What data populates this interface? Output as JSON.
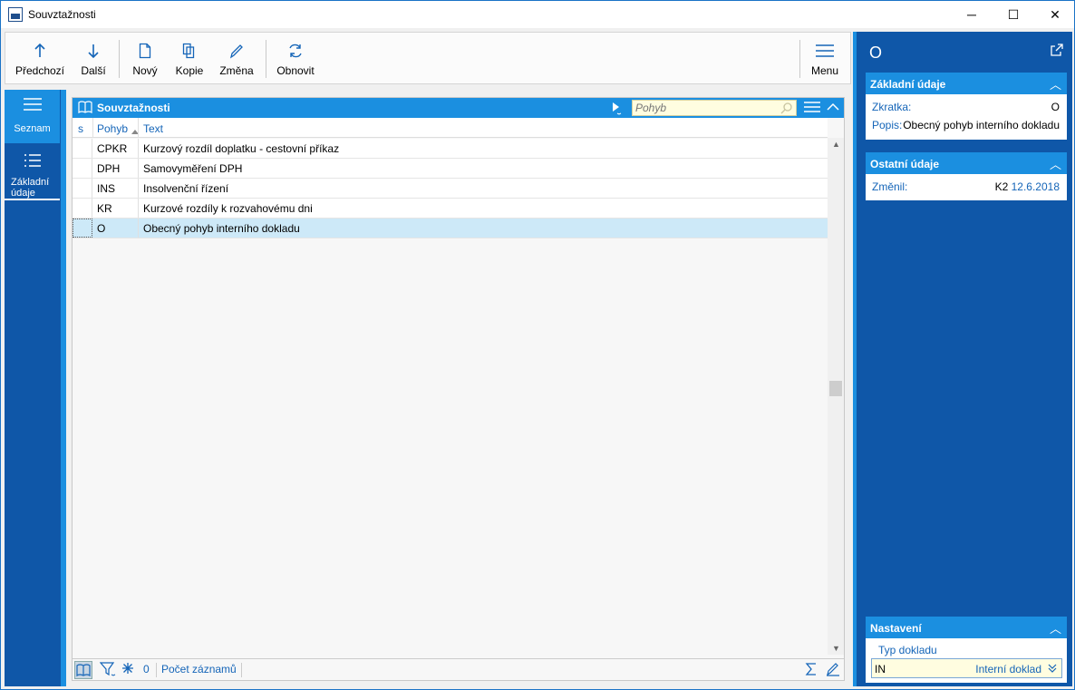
{
  "window": {
    "title": "Souvztažnosti",
    "min_glyph": "─",
    "max_glyph": "☐",
    "close_glyph": "✕"
  },
  "toolbar": {
    "buttons": [
      {
        "label": "Předchozí",
        "icon": "arrow-up-icon"
      },
      {
        "label": "Další",
        "icon": "arrow-down-icon"
      },
      {
        "label": "Nový",
        "icon": "new-document-icon"
      },
      {
        "label": "Kopie",
        "icon": "copy-icon"
      },
      {
        "label": "Změna",
        "icon": "pencil-icon"
      },
      {
        "label": "Obnovit",
        "icon": "refresh-icon"
      },
      {
        "label": "Menu",
        "icon": "hamburger-icon"
      }
    ]
  },
  "leftnav": {
    "items": [
      {
        "label": "Seznam",
        "icon": "hamburger-icon"
      },
      {
        "label": "Základní údaje",
        "icon": "list-icon"
      }
    ]
  },
  "grid": {
    "title": "Souvztažnosti",
    "search_placeholder": "Pohyb",
    "columns": [
      "s",
      "Pohyb",
      "Text"
    ],
    "rows": [
      {
        "pohyb": "CPKR",
        "text": "Kurzový rozdíl doplatku - cestovní příkaz",
        "selected": false
      },
      {
        "pohyb": "DPH",
        "text": "Samovyměření DPH",
        "selected": false
      },
      {
        "pohyb": "INS",
        "text": "Insolvenční řízení",
        "selected": false
      },
      {
        "pohyb": "KR",
        "text": "Kurzové rozdíly k rozvahovému dni",
        "selected": false
      },
      {
        "pohyb": "O",
        "text": "Obecný pohyb interního dokladu",
        "selected": true
      }
    ],
    "footer": {
      "count_value": "0",
      "count_label": "Počet záznamů"
    }
  },
  "rightpanel": {
    "title": "O",
    "zakladni": {
      "header": "Základní údaje",
      "zkratka_label": "Zkratka:",
      "zkratka_value": "O",
      "popis_label": "Popis:",
      "popis_value": "Obecný pohyb interního dokladu"
    },
    "ostatni": {
      "header": "Ostatní údaje",
      "zmenil_label": "Změnil:",
      "zmenil_user": "K2",
      "zmenil_date": "12.6.2018"
    },
    "nastaveni": {
      "header": "Nastavení",
      "typ_label": "Typ dokladu",
      "typ_code": "IN",
      "typ_desc": "Interní doklad"
    }
  },
  "colors": {
    "accent": "#1b8fe0",
    "dark_blue": "#0f57a8",
    "selected_row": "#cde9f8",
    "input_bg": "#fffde0"
  }
}
